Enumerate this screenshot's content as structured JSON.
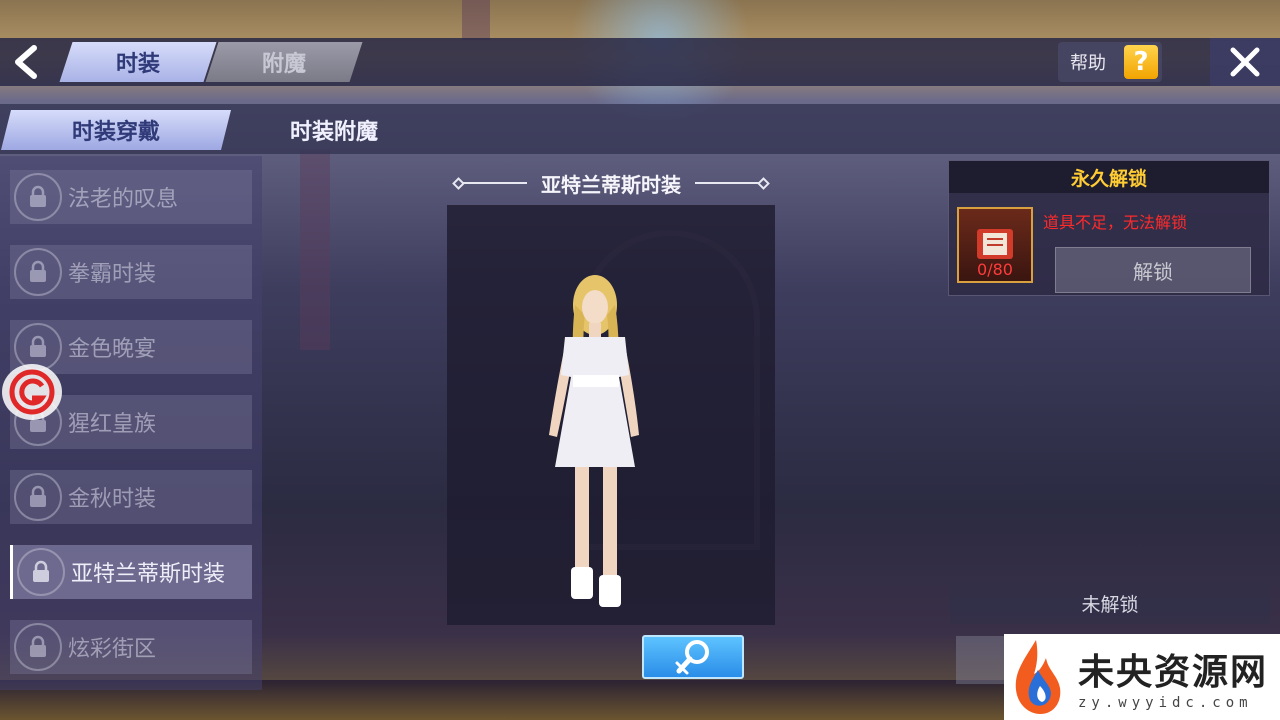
{
  "header": {
    "tabs": [
      {
        "label": "时装",
        "active": true
      },
      {
        "label": "附魔",
        "active": false
      }
    ],
    "help_label": "帮助",
    "help_icon": "?"
  },
  "sub_tabs": [
    {
      "label": "时装穿戴",
      "active": true
    },
    {
      "label": "时装附魔",
      "active": false
    }
  ],
  "costume_list": [
    {
      "label": "法老的叹息",
      "locked": true,
      "selected": false
    },
    {
      "label": "拳霸时装",
      "locked": true,
      "selected": false
    },
    {
      "label": "金色晚宴",
      "locked": true,
      "selected": false
    },
    {
      "label": "猩红皇族",
      "locked": true,
      "selected": false
    },
    {
      "label": "金秋时装",
      "locked": true,
      "selected": false
    },
    {
      "label": "亚特兰蒂斯时装",
      "locked": true,
      "selected": true
    },
    {
      "label": "炫彩街区",
      "locked": true,
      "selected": false
    }
  ],
  "preview": {
    "title": "亚特兰蒂斯时装"
  },
  "unlock_panel": {
    "title": "永久解锁",
    "item_count": "0/80",
    "warning": "道具不足，无法解锁",
    "unlock_button": "解锁"
  },
  "status": {
    "text": "未解锁"
  },
  "watermark": {
    "title": "未央资源网",
    "url": "zy.wyyidc.com"
  },
  "colors": {
    "accent_tab": "#a9b2e6",
    "gold": "#ffcc33",
    "warning_red": "#ff2a2a",
    "magnify_blue": "#2a8de8"
  }
}
